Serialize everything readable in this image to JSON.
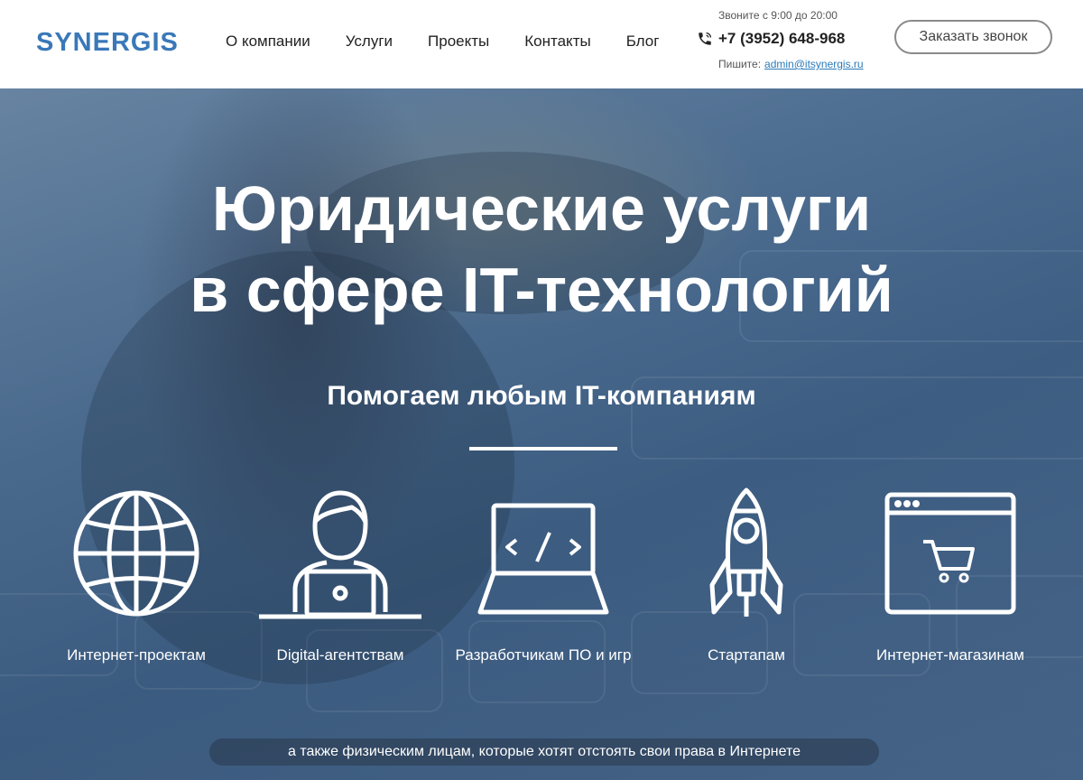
{
  "header": {
    "logo": "SYNERGIS",
    "nav": [
      {
        "label": "О компании"
      },
      {
        "label": "Услуги"
      },
      {
        "label": "Проекты"
      },
      {
        "label": "Контакты"
      },
      {
        "label": "Блог"
      }
    ],
    "hours": "Звоните с 9:00 до 20:00",
    "phone": "+7 (3952) 648-968",
    "email_prefix": "Пишите:",
    "email": "admin@itsynergis.ru",
    "callback_label": "Заказать звонок"
  },
  "hero": {
    "title_line1": "Юридические услуги",
    "title_line2": "в сфере IT-технологий",
    "subtitle": "Помогаем любым IT-компаниям",
    "tiles": [
      {
        "label": "Интернет-проектам",
        "icon": "globe-icon"
      },
      {
        "label": "Digital-агентствам",
        "icon": "developer-icon"
      },
      {
        "label": "Разработчикам ПО и игр",
        "icon": "laptop-code-icon"
      },
      {
        "label": "Стартапам",
        "icon": "rocket-icon"
      },
      {
        "label": "Интернет-магазинам",
        "icon": "browser-cart-icon"
      }
    ],
    "footer_note": "а также физическим лицам, которые хотят отстоять свои права в Интернете"
  },
  "colors": {
    "brand": "#3a78b8",
    "link": "#2b7bb9",
    "hero_bg": "#4f6f92",
    "text_on_hero": "#ffffff"
  }
}
